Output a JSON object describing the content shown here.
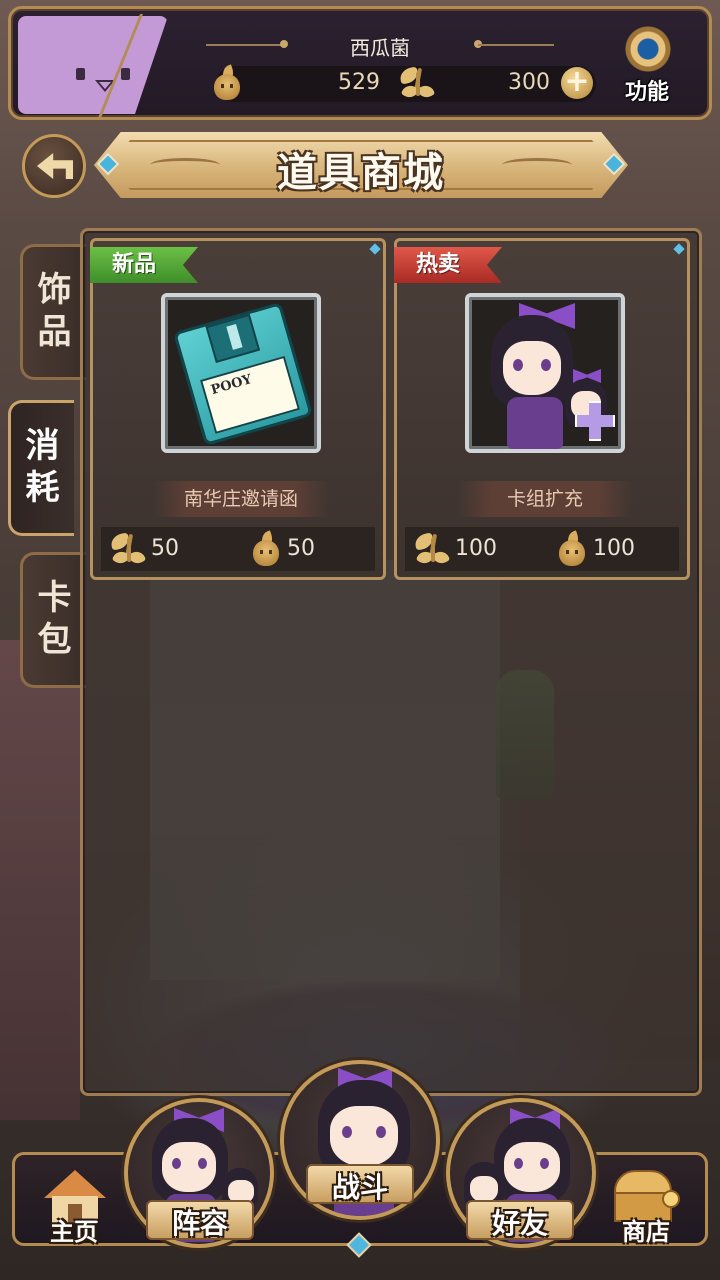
{
  "header": {
    "username": "西瓜菌",
    "currency": {
      "spirit": "529",
      "butterfly": "300"
    },
    "function_label": "功能"
  },
  "title": "道具商城",
  "side_tabs": [
    {
      "label_top": "饰",
      "label_bottom": "品",
      "active": false
    },
    {
      "label_top": "消",
      "label_bottom": "耗",
      "active": true
    },
    {
      "label_top": "卡",
      "label_bottom": "包",
      "active": false
    }
  ],
  "items": [
    {
      "ribbon": "新品",
      "ribbon_color": "#4f9f34",
      "name": "南华庄邀请函",
      "image_label": "POOY",
      "price_butterfly": "50",
      "price_spirit": "50"
    },
    {
      "ribbon": "热卖",
      "ribbon_color": "#c23a2f",
      "name": "卡组扩充",
      "price_butterfly": "100",
      "price_spirit": "100"
    }
  ],
  "nav": {
    "home": "主页",
    "lineup": "阵容",
    "battle": "战斗",
    "friends": "好友",
    "shop": "商店"
  },
  "colors": {
    "frame_gold": "#b48c52",
    "gem_blue": "#4fb6e0",
    "avatar_purple": "#c39ad6"
  }
}
